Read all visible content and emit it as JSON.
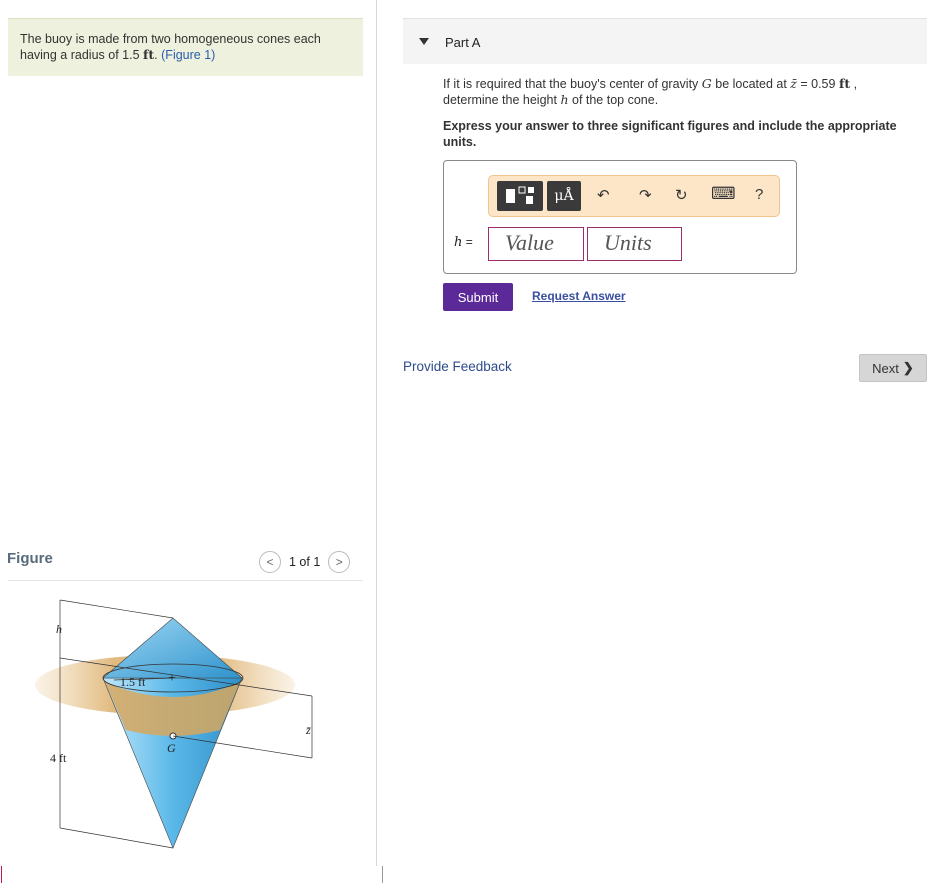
{
  "problem": {
    "text": "The buoy is made from two homogeneous cones each having a radius of 1.5",
    "unit": "ft",
    "period": ".",
    "figure_link": "(Figure 1)"
  },
  "figure_panel": {
    "label": "Figure",
    "pagination": "1 of 1",
    "prev_icon": "<",
    "next_icon": ">",
    "labels": {
      "h": "h",
      "radius": "1.5 ft",
      "bottom": "4 ft",
      "g": "G",
      "zbar": "z̄"
    }
  },
  "part": {
    "title": "Part A"
  },
  "question": {
    "pre": "If it is required that the buoy's center of gravity ",
    "var_g": "G",
    "mid": " be located at ",
    "var_z": "z̄",
    "eq": " = 0.59 ",
    "unit": "ft",
    "comma": " ,",
    "line2_pre": "determine the height ",
    "var_h": "h",
    "line2_post": " of the top cone."
  },
  "instruction": "Express your answer to three significant figures and include the appropriate units.",
  "answer": {
    "label_var": "h",
    "label_eq": " =",
    "value_placeholder": "Value",
    "units_placeholder": "Units",
    "toolbar": {
      "units_symbol": "μÅ",
      "undo_icon": "↶",
      "redo_icon": "↷",
      "reset_icon": "↻",
      "keyboard_icon": "⌨",
      "help_label": "?"
    }
  },
  "buttons": {
    "submit": "Submit",
    "request_answer": "Request Answer",
    "provide_feedback": "Provide Feedback",
    "next": "Next"
  },
  "colors": {
    "accent": "#5b2a98",
    "problem_bg": "#eef1dd",
    "toolbar_bg": "#fde5c8",
    "cone": "#5bb8e8"
  }
}
